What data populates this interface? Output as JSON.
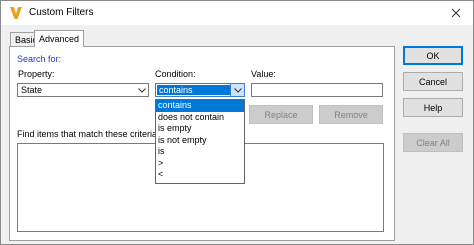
{
  "window": {
    "title": "Custom Filters"
  },
  "tabs": [
    {
      "label": "Basic"
    },
    {
      "label": "Advanced"
    }
  ],
  "search_for_label": "Search for:",
  "property": {
    "label": "Property:",
    "value": "State"
  },
  "condition": {
    "label": "Condition:",
    "value": "contains"
  },
  "value_field": {
    "label": "Value:",
    "value": ""
  },
  "condition_options": [
    "contains",
    "does not contain",
    "is empty",
    "is not empty",
    "is",
    ">",
    "<"
  ],
  "buttons": {
    "replace": "Replace",
    "remove": "Remove",
    "ok": "OK",
    "cancel": "Cancel",
    "help": "Help",
    "clear_all": "Clear All"
  },
  "results_label": "Find items that match these criteria:",
  "colors": {
    "accent": "#0078d7",
    "link_blue": "#1a3fbf",
    "app_icon": "#f0a020"
  }
}
